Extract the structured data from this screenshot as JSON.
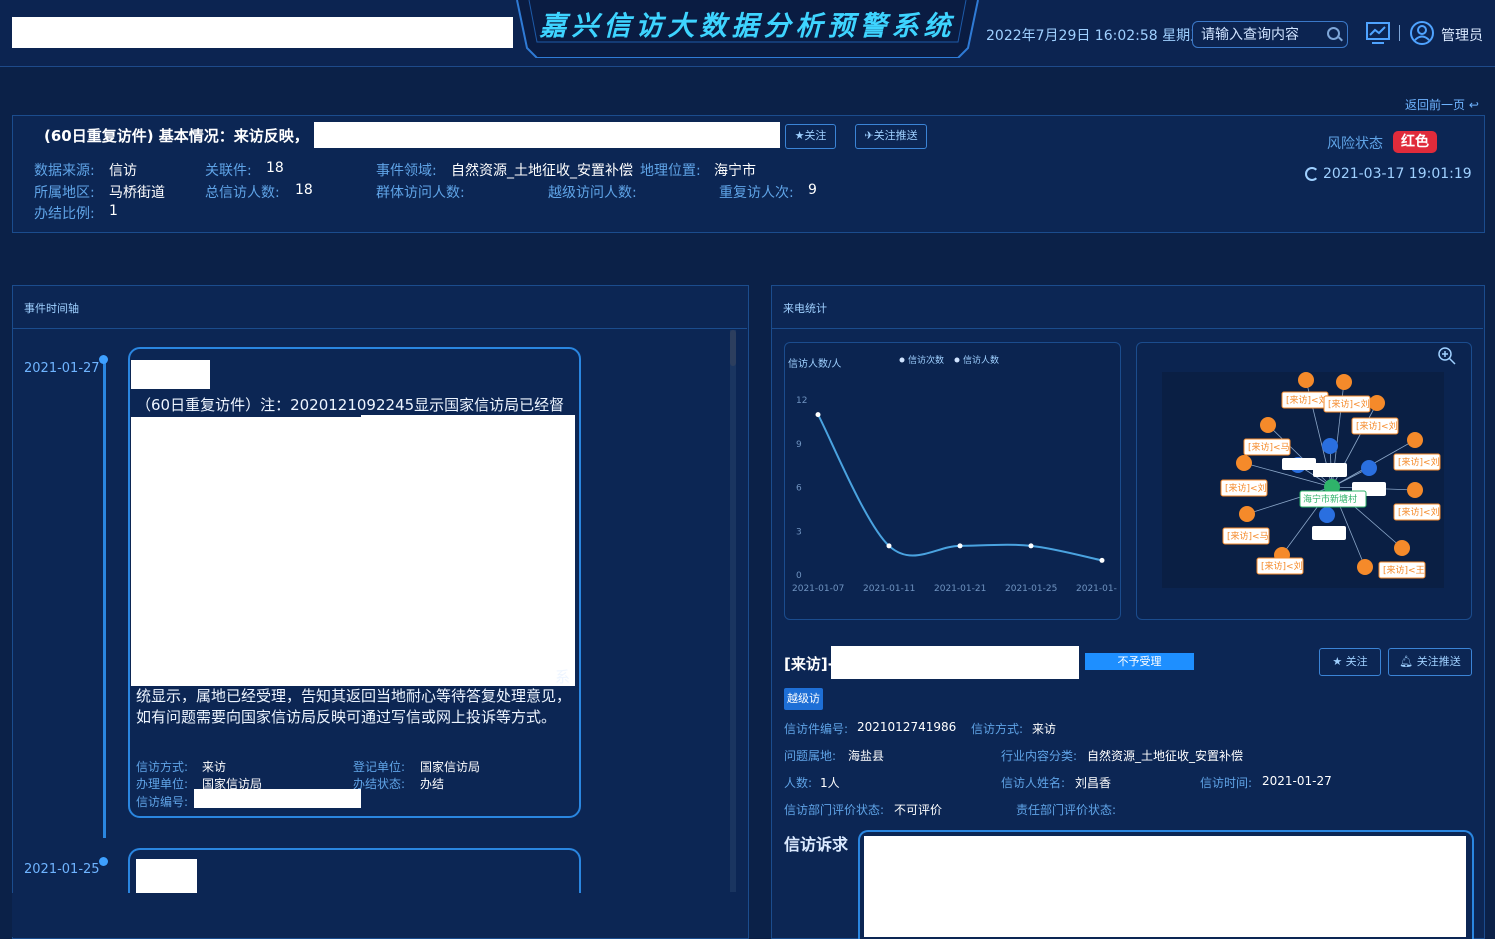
{
  "header": {
    "title": "嘉兴信访大数据分析预警系统",
    "datetime": "2022年7月29日 16:02:58 星期五",
    "search_placeholder": "请输入查询内容",
    "search_icon": "search-icon",
    "user": "管理员",
    "accent_color": "#3ed4ff"
  },
  "back_link": "返回前一页",
  "info": {
    "title": "(60日重复访件) 基本情况：来访反映，",
    "follow_btn": "★关注",
    "push_btn": "✈关注推送",
    "fields": {
      "data_source": {
        "label": "数据来源:",
        "value": "信访"
      },
      "related": {
        "label": "关联件:",
        "value": "18"
      },
      "domain": {
        "label": "事件领域:",
        "value": "自然资源_土地征收_安置补偿"
      },
      "location": {
        "label": "地理位置:",
        "value": "海宁市"
      },
      "region": {
        "label": "所属地区:",
        "value": "马桥街道"
      },
      "total_people": {
        "label": "总信访人数:",
        "value": "18"
      },
      "group_people": {
        "label": "群体访问人数:",
        "value": ""
      },
      "skip_level": {
        "label": "越级访问人数:",
        "value": ""
      },
      "repeat_visits": {
        "label": "重复访人次:",
        "value": "9"
      },
      "handle_ratio": {
        "label": "办结比例:",
        "value": "1"
      }
    },
    "risk_label": "风险状态",
    "risk_value": "红色",
    "risk_color": "#e02b3b",
    "risk_time": "2021-03-17 19:01:19"
  },
  "timeline": {
    "title": "事件时间轴",
    "items": [
      {
        "date": "2021-01-27",
        "text_head": "（60日重复访件）注：2020121092245显示国家信访局已经督办，鉴于该信访件显示已经受理，",
        "text_tail": "系",
        "text_body": "统显示，属地已经受理，告知其返回当地耐心等待答复处理意见，如有问题需要向国家信访局反映可通过写信或网上投诉等方式。",
        "method_label": "信访方式:",
        "method": "来访",
        "reg_label": "登记单位:",
        "reg": "国家信访局",
        "unit_label": "办理单位:",
        "unit": "国家信访局",
        "status_label": "办结状态:",
        "status": "办结",
        "no_label": "信访编号:"
      },
      {
        "date": "2021-01-25"
      }
    ]
  },
  "stats": {
    "title": "来电统计",
    "zoom_icon": "zoom-in-icon"
  },
  "chart_data": {
    "type": "line",
    "ylabel": "信访人数/人",
    "legend": [
      "信访次数",
      "信访人数"
    ],
    "legend_position": "top",
    "x": [
      "2021-01-07",
      "2021-01-11",
      "2021-01-21",
      "2021-01-25",
      "2021-01-27"
    ],
    "x_tick_labels": [
      "2021-01-07",
      "2021-01-11",
      "2021-01-21",
      "2021-01-25",
      "2021-01-"
    ],
    "series": [
      {
        "name": "信访人数",
        "values": [
          11,
          2,
          2,
          2,
          1
        ]
      }
    ],
    "yticks": [
      0,
      3,
      6,
      9,
      12
    ],
    "ylim": [
      0,
      12
    ],
    "grid": false,
    "line_color": "#4aa3e0"
  },
  "graph": {
    "nodes": [
      "[来访]<刘",
      "[来访]<刘",
      "[来访]<刘",
      "[来访]<马",
      "[来访]<刘",
      "[来访]<刘",
      "[来访]<刘",
      "[来访]<马",
      "[来访]<刘",
      "[来访]<王",
      "海宁市新塘村"
    ]
  },
  "detail": {
    "title": "[来访]-",
    "status_badge": "不予受理",
    "follow_btn": "★ 关注",
    "push_btn": "关注推送",
    "tag": "越级访",
    "fields": {
      "case_no": {
        "label": "信访件编号:",
        "value": "2021012741986"
      },
      "method": {
        "label": "信访方式:",
        "value": "来访"
      },
      "place": {
        "label": "问题属地:",
        "value": "海盐县"
      },
      "industry": {
        "label": "行业内容分类:",
        "value": "自然资源_土地征收_安置补偿"
      },
      "count": {
        "label": "人数:",
        "value": "1人"
      },
      "name": {
        "label": "信访人姓名:",
        "value": "刘昌香"
      },
      "time": {
        "label": "信访时间:",
        "value": "2021-01-27"
      },
      "dept_eval": {
        "label": "信访部门评价状态:",
        "value": "不可评价"
      },
      "resp_eval": {
        "label": "责任部门评价状态:",
        "value": ""
      }
    },
    "appeal_title": "信访诉求"
  }
}
